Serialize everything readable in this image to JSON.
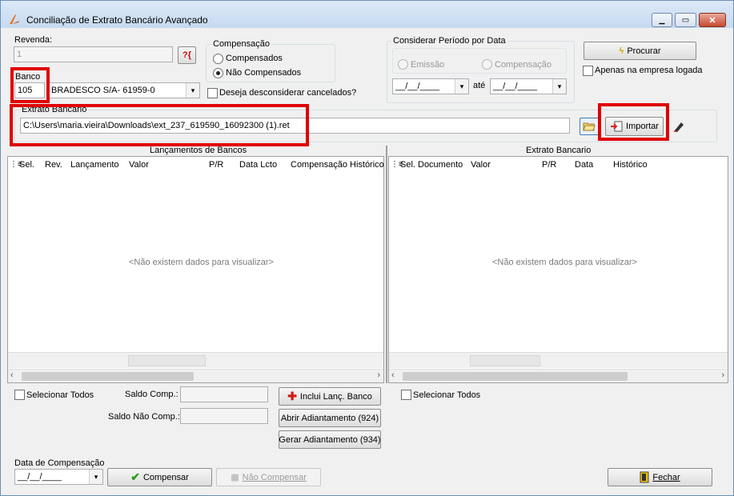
{
  "window": {
    "title": "Conciliação de Extrato Bancário Avançado",
    "min": "▁",
    "max": "▭",
    "close": "✕"
  },
  "revenda": {
    "label": "Revenda:",
    "value": "1"
  },
  "compensacao": {
    "group_label": "Compensação",
    "opt1": "Compensados",
    "opt2": "Não Compensados",
    "selected": "Não Compensados"
  },
  "banco": {
    "label": "Banco",
    "code": "105",
    "name": "BRADESCO S/A- 61959-0"
  },
  "desconsiderar_cancelados": "Deseja desconsiderar cancelados?",
  "periodo": {
    "group_label": "Considerar Período por Data",
    "opt_emissao": "Emissão",
    "opt_compensacao": "Compensação",
    "date_from": "__/__/____",
    "ate": "até",
    "date_to": "__/__/____"
  },
  "procurar": "Procurar",
  "apenas_empresa": "Apenas na empresa logada",
  "extrato": {
    "label": "Extrato Bancário",
    "path": "C:\\Users\\maria.vieira\\Downloads\\ext_237_619590_16092300 (1).ret"
  },
  "importar": "Importar",
  "left_grid": {
    "title": "Lançamentos de Bancos",
    "columns": [
      "Sel.",
      "Rev.",
      "Lançamento",
      "Valor",
      "P/R",
      "Data Lcto",
      "Compensação",
      "Histórico"
    ],
    "empty": "<Não existem dados para visualizar>"
  },
  "right_grid": {
    "title": "Extrato Bancario",
    "columns": [
      "Sel.",
      "Documento",
      "Valor",
      "P/R",
      "Data",
      "Histórico"
    ],
    "empty": "<Não existem dados para visualizar>"
  },
  "left_select_all": "Selecionar Todos",
  "right_select_all": "Selecionar Todos",
  "saldo_comp": "Saldo Comp.:",
  "saldo_nao_comp": "Saldo Não Comp.:",
  "inclui_lanc": "Inclui Lanç. Banco",
  "abrir_adiantamento": "Abrir Adiantamento (924)",
  "gerar_adiantamento": "Gerar Adiantamento (934)",
  "data_compensacao": {
    "label": "Data de Compensação",
    "value": "__/__/____"
  },
  "compensar": "Compensar",
  "nao_compensar": "Não Compensar",
  "fechar": "Fechar",
  "colors": {
    "highlight": "#e00000",
    "titlebar": "#c5d9f0"
  }
}
